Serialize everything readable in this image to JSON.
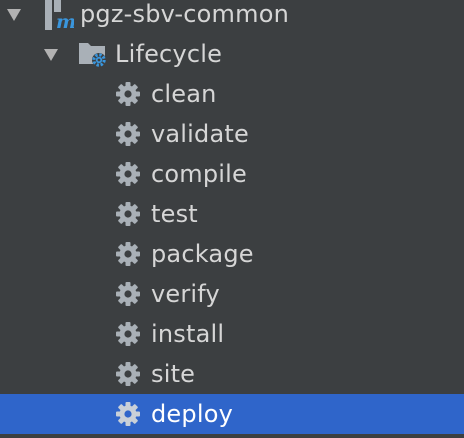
{
  "tree": {
    "project": {
      "label": "pgz-sbv-common",
      "icon": "maven-module-icon",
      "expanded": true
    },
    "lifecycle": {
      "label": "Lifecycle",
      "icon": "lifecycle-folder-icon",
      "expanded": true
    },
    "phases": [
      {
        "label": "clean"
      },
      {
        "label": "validate"
      },
      {
        "label": "compile"
      },
      {
        "label": "test"
      },
      {
        "label": "package"
      },
      {
        "label": "verify"
      },
      {
        "label": "install"
      },
      {
        "label": "site"
      },
      {
        "label": "deploy"
      }
    ],
    "selected_index": 8
  },
  "colors": {
    "background": "#3c3f41",
    "selection": "#2f65ca",
    "text": "#d6d6d6",
    "icon_gray": "#a9b0b7",
    "maven_blue": "#3a96dd"
  }
}
